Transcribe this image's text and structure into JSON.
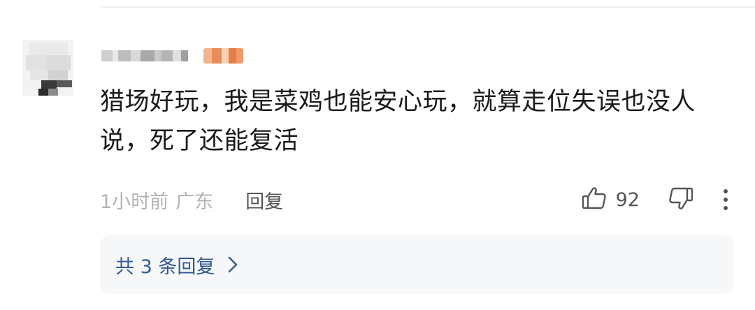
{
  "comment": {
    "text": "猎场好玩，我是菜鸡也能安心玩，就算走位失误也没人说，死了还能复活",
    "time": "1小时前",
    "location": "广东",
    "reply_label": "回复",
    "like_count": "92"
  },
  "replies_summary": {
    "label": "共 3 条回复"
  },
  "icons": {
    "like": "thumbs-up-icon",
    "dislike": "thumbs-down-icon",
    "more": "more-vertical-icon",
    "chevron": "chevron-right-icon"
  },
  "colors": {
    "link_blue": "#2e5a96",
    "text_primary": "#1a1a1a",
    "text_muted": "#b3b3b3"
  }
}
